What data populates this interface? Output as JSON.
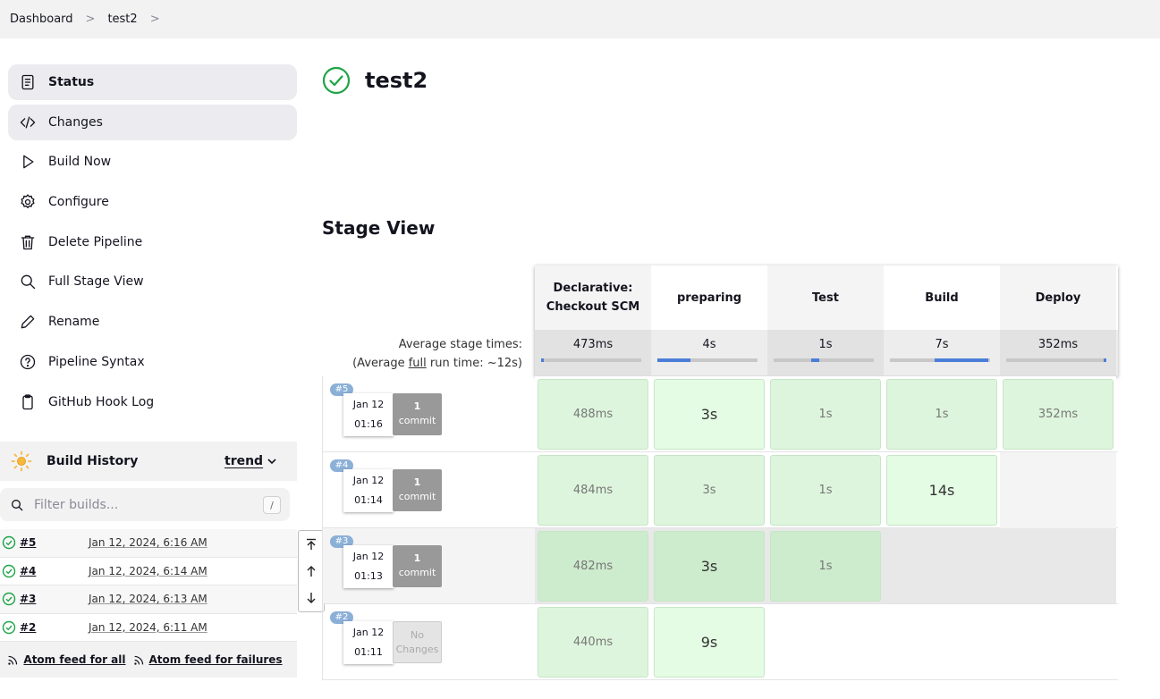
{
  "breadcrumb": {
    "items": [
      "Dashboard",
      "test2"
    ]
  },
  "sidebar": {
    "items": [
      {
        "label": "Status",
        "icon": "document-icon"
      },
      {
        "label": "Changes",
        "icon": "code-icon"
      },
      {
        "label": "Build Now",
        "icon": "play-icon"
      },
      {
        "label": "Configure",
        "icon": "gear-icon"
      },
      {
        "label": "Delete Pipeline",
        "icon": "trash-icon"
      },
      {
        "label": "Full Stage View",
        "icon": "search-icon"
      },
      {
        "label": "Rename",
        "icon": "pencil-icon"
      },
      {
        "label": "Pipeline Syntax",
        "icon": "help-icon"
      },
      {
        "label": "GitHub Hook Log",
        "icon": "clipboard-icon"
      }
    ]
  },
  "build_history": {
    "title": "Build History",
    "trend": "trend",
    "filter_placeholder": "Filter builds...",
    "filter_shortcut": "/",
    "builds": [
      {
        "num": "#5",
        "date": "Jan 12, 2024, 6:16 AM"
      },
      {
        "num": "#4",
        "date": "Jan 12, 2024, 6:14 AM"
      },
      {
        "num": "#3",
        "date": "Jan 12, 2024, 6:13 AM"
      },
      {
        "num": "#2",
        "date": "Jan 12, 2024, 6:11 AM"
      }
    ],
    "feed_all": "Atom feed for all",
    "feed_failures": "Atom feed for failures"
  },
  "main": {
    "title": "test2",
    "stage_view_title": "Stage View",
    "avg_label_1": "Average stage times:",
    "avg_label_2a": "(Average ",
    "avg_label_2b": "full",
    "avg_label_2c": " run time: ~12s)"
  },
  "stages": [
    {
      "name1": "Declarative:",
      "name2": "Checkout SCM",
      "avg": "473ms",
      "bar": 0.01
    },
    {
      "name1": "preparing",
      "name2": "",
      "avg": "4s",
      "bar": 0.33
    },
    {
      "name1": "Test",
      "name2": "",
      "avg": "1s",
      "bar": 0.08
    },
    {
      "name1": "Build",
      "name2": "",
      "avg": "7s",
      "bar": 0.54
    },
    {
      "name1": "Deploy",
      "name2": "",
      "avg": "352ms",
      "bar": 0.01
    }
  ],
  "runs": [
    {
      "tag": "#5",
      "date": "Jan 12",
      "time": "01:16",
      "commit_num": "1",
      "commit_label": "commit",
      "no_changes": false,
      "cells": [
        "488ms",
        "3s",
        "1s",
        "1s",
        "352ms"
      ]
    },
    {
      "tag": "#4",
      "date": "Jan 12",
      "time": "01:14",
      "commit_num": "1",
      "commit_label": "commit",
      "no_changes": false,
      "cells": [
        "484ms",
        "3s",
        "1s",
        "14s",
        ""
      ]
    },
    {
      "tag": "#3",
      "date": "Jan 12",
      "time": "01:13",
      "commit_num": "1",
      "commit_label": "commit",
      "no_changes": false,
      "cells": [
        "482ms",
        "3s",
        "1s",
        "",
        ""
      ]
    },
    {
      "tag": "#2",
      "date": "Jan 12",
      "time": "01:11",
      "commit_num": "No",
      "commit_label": "Changes",
      "no_changes": true,
      "cells": [
        "440ms",
        "9s",
        "",
        "",
        ""
      ]
    }
  ],
  "colors": {
    "success": "#1ea446",
    "stage_bar": "#4a7ed8",
    "stage_cell": "#ddf5dd"
  }
}
